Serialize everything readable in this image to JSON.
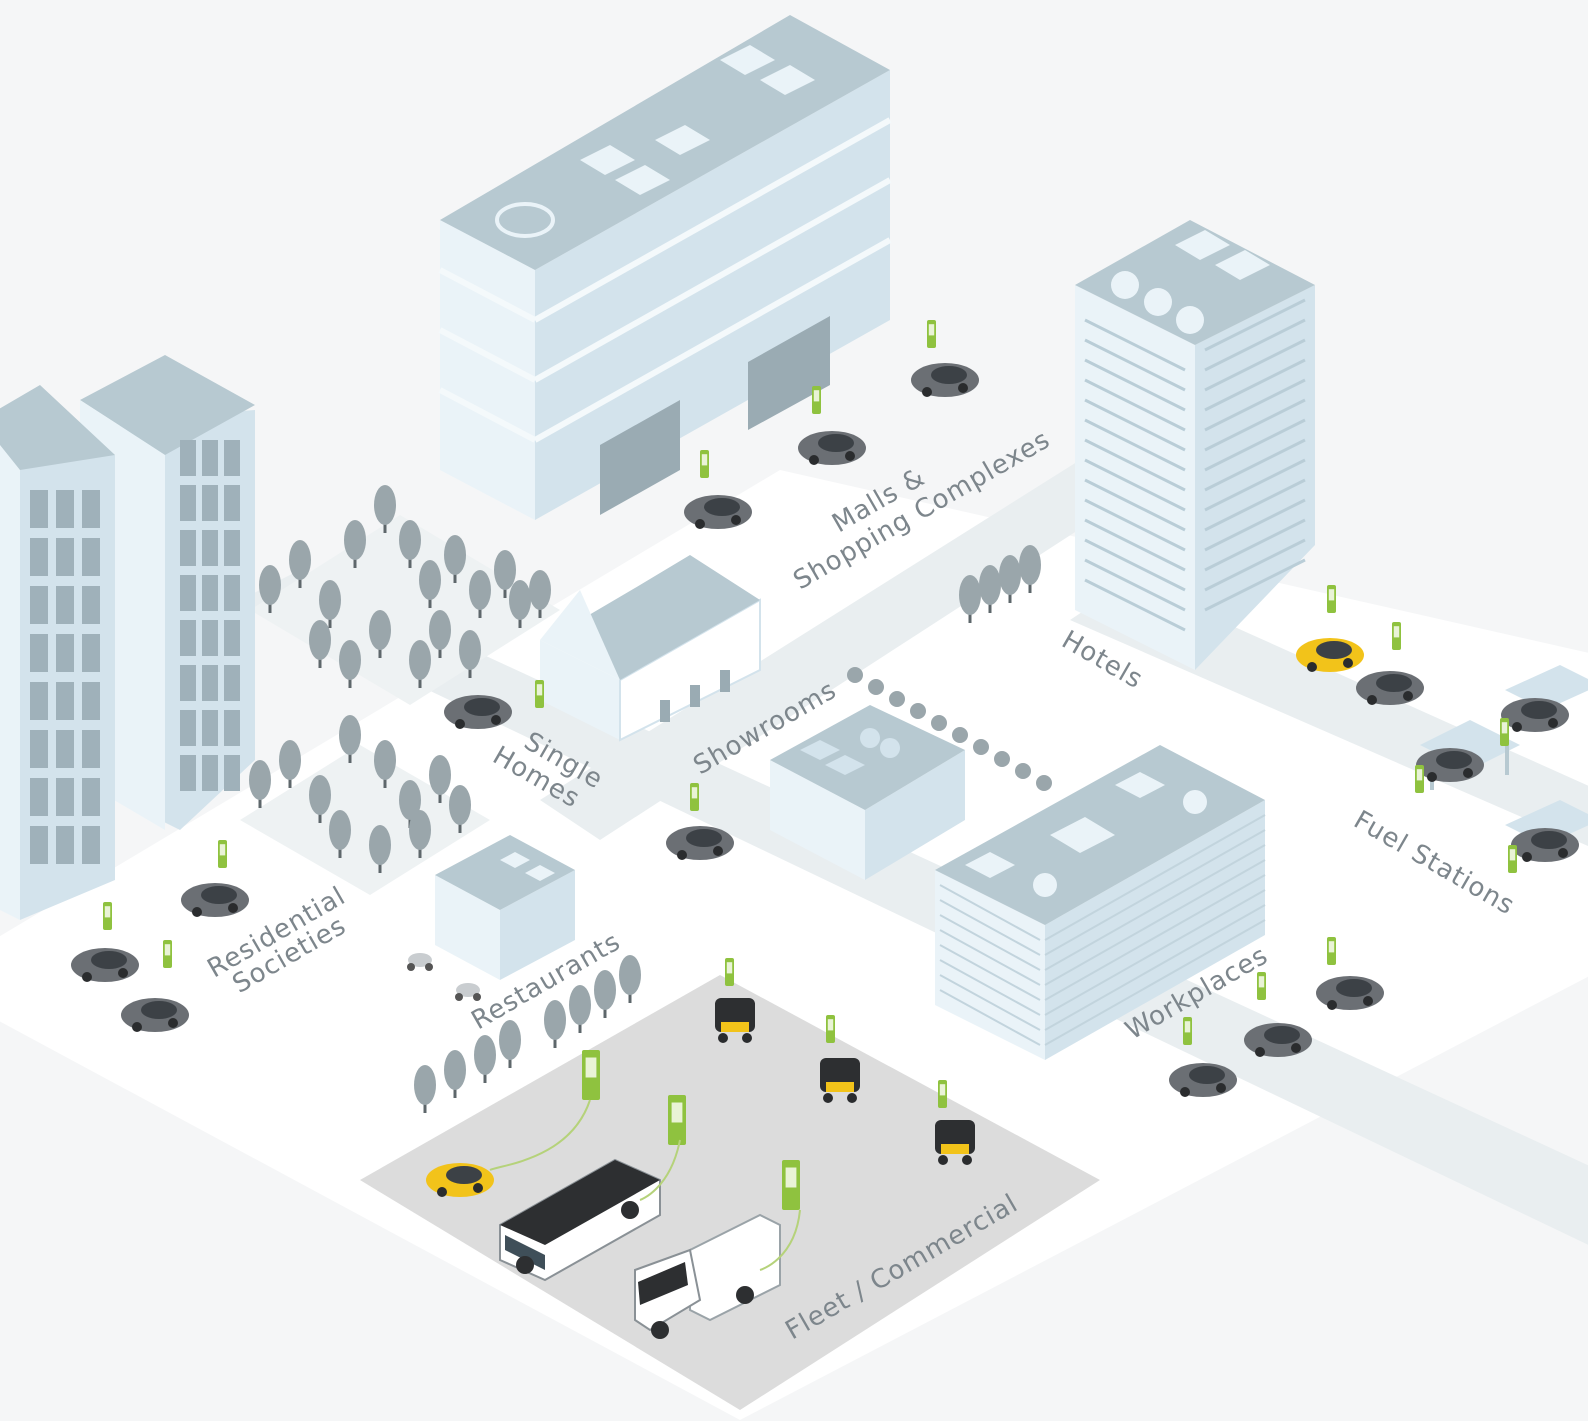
{
  "zones": {
    "malls": {
      "line1": "Malls &",
      "line2": "Shopping Complexes"
    },
    "hotels": "Hotels",
    "single_homes": {
      "line1": "Single",
      "line2": "Homes"
    },
    "showrooms": "Showrooms",
    "residential": {
      "line1": "Residential",
      "line2": "Societies"
    },
    "restaurants": "Restaurants",
    "fuel_stations": "Fuel Stations",
    "workplaces": "Workplaces",
    "fleet": "Fleet / Commercial"
  },
  "colors": {
    "background": "#f5f6f7",
    "ground": "#ffffff",
    "road": "#e9eef0",
    "fleet_lot": "#dcdcdc",
    "building_top": "#b7c9d1",
    "building_left": "#eaf3f8",
    "building_right": "#d3e3ec",
    "charger": "#8fc23f",
    "car_grey": "#6b6f74",
    "car_yellow": "#f2c31a",
    "tree": "#9aa6ab",
    "label_text": "#7d868c"
  },
  "icons": [
    "ev-charger-icon",
    "car-icon",
    "taxi-icon",
    "auto-rickshaw-icon",
    "bus-icon",
    "truck-icon",
    "scooter-icon",
    "tree-icon"
  ]
}
